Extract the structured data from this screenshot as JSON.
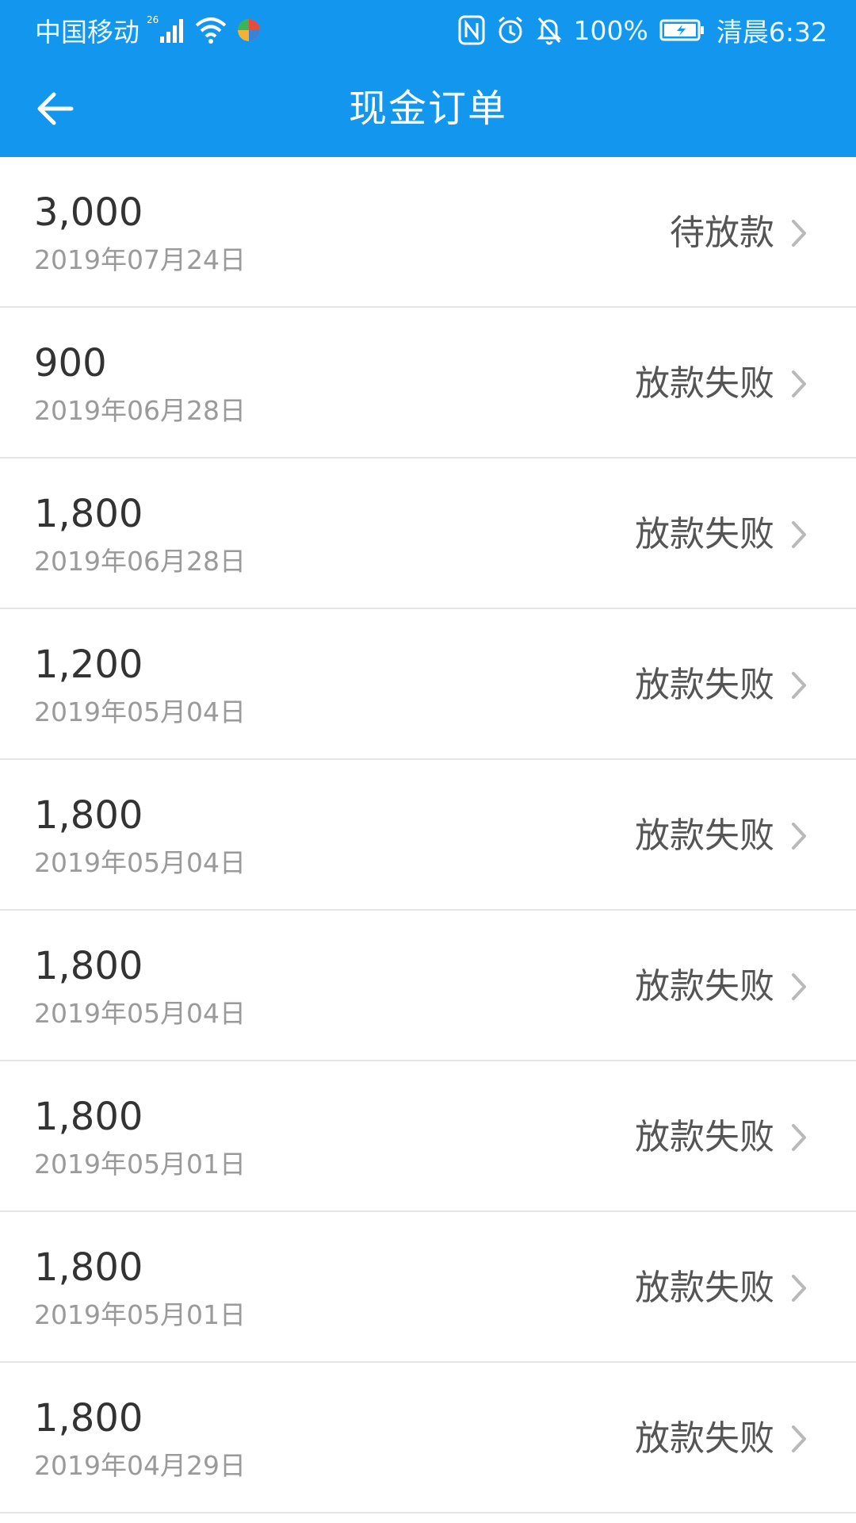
{
  "statusbar": {
    "carrier": "中国移动",
    "network": "26",
    "battery": "100%",
    "time": "清晨6:32",
    "icons": [
      "signal-icon",
      "wifi-icon",
      "app-notification-icon",
      "nfc-icon",
      "alarm-icon",
      "mute-icon",
      "battery-icon"
    ]
  },
  "header": {
    "title": "现金订单",
    "back_icon": "back-arrow-icon",
    "background_color": "#1296ee"
  },
  "orders": [
    {
      "amount": "3,000",
      "date": "2019年07月24日",
      "status": "待放款"
    },
    {
      "amount": "900",
      "date": "2019年06月28日",
      "status": "放款失败"
    },
    {
      "amount": "1,800",
      "date": "2019年06月28日",
      "status": "放款失败"
    },
    {
      "amount": "1,200",
      "date": "2019年05月04日",
      "status": "放款失败"
    },
    {
      "amount": "1,800",
      "date": "2019年05月04日",
      "status": "放款失败"
    },
    {
      "amount": "1,800",
      "date": "2019年05月04日",
      "status": "放款失败"
    },
    {
      "amount": "1,800",
      "date": "2019年05月01日",
      "status": "放款失败"
    },
    {
      "amount": "1,800",
      "date": "2019年05月01日",
      "status": "放款失败"
    },
    {
      "amount": "1,800",
      "date": "2019年04月29日",
      "status": "放款失败"
    }
  ]
}
